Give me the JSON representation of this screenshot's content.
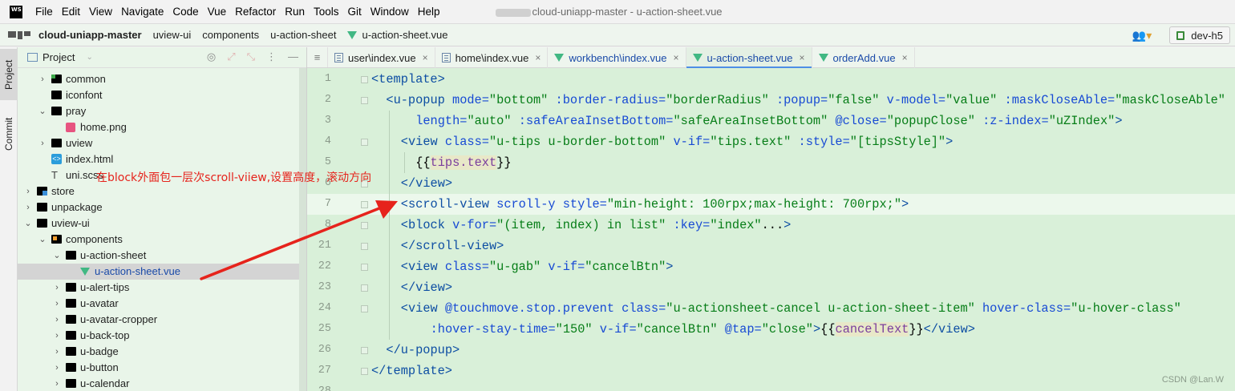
{
  "menubar": {
    "logo": "WS",
    "items": [
      "File",
      "Edit",
      "View",
      "Navigate",
      "Code",
      "Vue",
      "Refactor",
      "Run",
      "Tools",
      "Git",
      "Window",
      "Help"
    ],
    "title": "cloud-uniapp-master - u-action-sheet.vue"
  },
  "navbar": {
    "crumbs": [
      "cloud-uniapp-master",
      "uview-ui",
      "components",
      "u-action-sheet",
      "u-action-sheet.vue"
    ],
    "branch": "dev-h5"
  },
  "toolstrip": {
    "project_tab": "Project",
    "commit_tab": "Commit"
  },
  "project": {
    "title": "Project",
    "tree": [
      {
        "label": "common",
        "depth": 2,
        "type": "folder-green",
        "expanded": false
      },
      {
        "label": "iconfont",
        "depth": 2,
        "type": "folder",
        "expanded": null
      },
      {
        "label": "pray",
        "depth": 2,
        "type": "folder",
        "expanded": true
      },
      {
        "label": "home.png",
        "depth": 3,
        "type": "png",
        "expanded": null
      },
      {
        "label": "uview",
        "depth": 2,
        "type": "folder",
        "expanded": false
      },
      {
        "label": "index.html",
        "depth": 2,
        "type": "html",
        "expanded": null
      },
      {
        "label": "uni.scss",
        "depth": 2,
        "type": "text",
        "expanded": null
      },
      {
        "label": "store",
        "depth": 1,
        "type": "folder-store",
        "expanded": false
      },
      {
        "label": "unpackage",
        "depth": 1,
        "type": "folder",
        "expanded": false
      },
      {
        "label": "uview-ui",
        "depth": 1,
        "type": "folder",
        "expanded": true
      },
      {
        "label": "components",
        "depth": 2,
        "type": "folder-orange",
        "expanded": true
      },
      {
        "label": "u-action-sheet",
        "depth": 3,
        "type": "folder",
        "expanded": true
      },
      {
        "label": "u-action-sheet.vue",
        "depth": 4,
        "type": "vue",
        "expanded": null,
        "selected": true
      },
      {
        "label": "u-alert-tips",
        "depth": 3,
        "type": "folder",
        "expanded": false
      },
      {
        "label": "u-avatar",
        "depth": 3,
        "type": "folder",
        "expanded": false
      },
      {
        "label": "u-avatar-cropper",
        "depth": 3,
        "type": "folder",
        "expanded": false
      },
      {
        "label": "u-back-top",
        "depth": 3,
        "type": "folder",
        "expanded": false
      },
      {
        "label": "u-badge",
        "depth": 3,
        "type": "folder",
        "expanded": false
      },
      {
        "label": "u-button",
        "depth": 3,
        "type": "folder",
        "expanded": false
      },
      {
        "label": "u-calendar",
        "depth": 3,
        "type": "folder",
        "expanded": false
      }
    ]
  },
  "tabs": [
    {
      "label": "user\\index.vue",
      "kind": "doc",
      "active": false
    },
    {
      "label": "home\\index.vue",
      "kind": "doc",
      "active": false
    },
    {
      "label": "workbench\\index.vue",
      "kind": "vue",
      "active": false
    },
    {
      "label": "u-action-sheet.vue",
      "kind": "vue",
      "active": true
    },
    {
      "label": "orderAdd.vue",
      "kind": "vue",
      "active": false
    }
  ],
  "editor": {
    "current_line": 7,
    "lines": [
      {
        "n": "1",
        "indent": 0,
        "parts": [
          [
            "t",
            "<template>"
          ]
        ]
      },
      {
        "n": "2",
        "indent": 1,
        "parts": [
          [
            "t",
            "<u-popup "
          ],
          [
            "a",
            "mode="
          ],
          [
            "s",
            "\"bottom\" "
          ],
          [
            "a",
            ":border-radius="
          ],
          [
            "s",
            "\"borderRadius\" "
          ],
          [
            "a",
            ":popup="
          ],
          [
            "s",
            "\"false\" "
          ],
          [
            "a",
            "v-model="
          ],
          [
            "s",
            "\"value\" "
          ],
          [
            "a",
            ":maskCloseAble="
          ],
          [
            "s",
            "\"maskCloseAble\""
          ]
        ]
      },
      {
        "n": "3",
        "indent": 3,
        "parts": [
          [
            "a",
            "length="
          ],
          [
            "s",
            "\"auto\" "
          ],
          [
            "a",
            ":safeAreaInsetBottom="
          ],
          [
            "s",
            "\"safeAreaInsetBottom\" "
          ],
          [
            "a",
            "@close="
          ],
          [
            "s",
            "\"popupClose\" "
          ],
          [
            "a",
            ":z-index="
          ],
          [
            "s",
            "\"uZIndex\""
          ],
          [
            "t",
            ">"
          ]
        ]
      },
      {
        "n": "4",
        "indent": 2,
        "parts": [
          [
            "t",
            "<view "
          ],
          [
            "a",
            "class="
          ],
          [
            "s",
            "\"u-tips u-border-bottom\" "
          ],
          [
            "a",
            "v-if="
          ],
          [
            "s",
            "\"tips.text\" "
          ],
          [
            "a",
            ":style="
          ],
          [
            "s",
            "\"[tipsStyle]\""
          ],
          [
            "t",
            ">"
          ]
        ]
      },
      {
        "n": "5",
        "indent": 3,
        "parts": [
          [
            "p",
            "{{"
          ],
          [
            "v",
            "tips.text"
          ],
          [
            "p",
            "}}"
          ]
        ]
      },
      {
        "n": "6",
        "indent": 2,
        "parts": [
          [
            "t",
            "</view>"
          ]
        ]
      },
      {
        "n": "7",
        "indent": 2,
        "parts": [
          [
            "t",
            "<scroll-view "
          ],
          [
            "a",
            "scroll-y style="
          ],
          [
            "s",
            "\"min-height: 100rpx;max-height: 700rpx;\""
          ],
          [
            "t",
            ">"
          ]
        ]
      },
      {
        "n": "8",
        "indent": 2,
        "parts": [
          [
            "t",
            "<block "
          ],
          [
            "a",
            "v-for="
          ],
          [
            "s",
            "\"(item, index) in list\" "
          ],
          [
            "a",
            ":key="
          ],
          [
            "s",
            "\"index\""
          ],
          [
            "p",
            "..."
          ],
          [
            "t",
            ">"
          ]
        ]
      },
      {
        "n": "21",
        "indent": 2,
        "parts": [
          [
            "t",
            "</scroll-view>"
          ]
        ]
      },
      {
        "n": "22",
        "indent": 2,
        "parts": [
          [
            "t",
            "<view "
          ],
          [
            "a",
            "class="
          ],
          [
            "s",
            "\"u-gab\" "
          ],
          [
            "a",
            "v-if="
          ],
          [
            "s",
            "\"cancelBtn\""
          ],
          [
            "t",
            ">"
          ]
        ]
      },
      {
        "n": "23",
        "indent": 2,
        "parts": [
          [
            "t",
            "</view>"
          ]
        ]
      },
      {
        "n": "24",
        "indent": 2,
        "parts": [
          [
            "t",
            "<view "
          ],
          [
            "a",
            "@touchmove.stop.prevent class="
          ],
          [
            "s",
            "\"u-actionsheet-cancel u-action-sheet-item\" "
          ],
          [
            "a",
            "hover-class="
          ],
          [
            "s",
            "\"u-hover-class\""
          ]
        ]
      },
      {
        "n": "25",
        "indent": 4,
        "parts": [
          [
            "a",
            ":hover-stay-time="
          ],
          [
            "s",
            "\"150\" "
          ],
          [
            "a",
            "v-if="
          ],
          [
            "s",
            "\"cancelBtn\" "
          ],
          [
            "a",
            "@tap="
          ],
          [
            "s",
            "\"close\""
          ],
          [
            "t",
            ">"
          ],
          [
            "p",
            "{{"
          ],
          [
            "v",
            "cancelText"
          ],
          [
            "p",
            "}}"
          ],
          [
            "t",
            "</view>"
          ]
        ]
      },
      {
        "n": "26",
        "indent": 1,
        "parts": [
          [
            "t",
            "</u-popup>"
          ]
        ]
      },
      {
        "n": "27",
        "indent": 0,
        "parts": [
          [
            "t",
            "</template>"
          ]
        ]
      },
      {
        "n": "28",
        "indent": 0,
        "parts": []
      }
    ]
  },
  "annotation": {
    "text": "在block外面包一层次scroll-viiew,设置高度，滚动方向"
  },
  "watermark": "CSDN @Lan.W",
  "colors": {
    "editor_bg": "#d9f0d9",
    "current_line": "#ecf8ec",
    "annotation": "#e6231c",
    "tab_active": "#4e8ee6"
  }
}
